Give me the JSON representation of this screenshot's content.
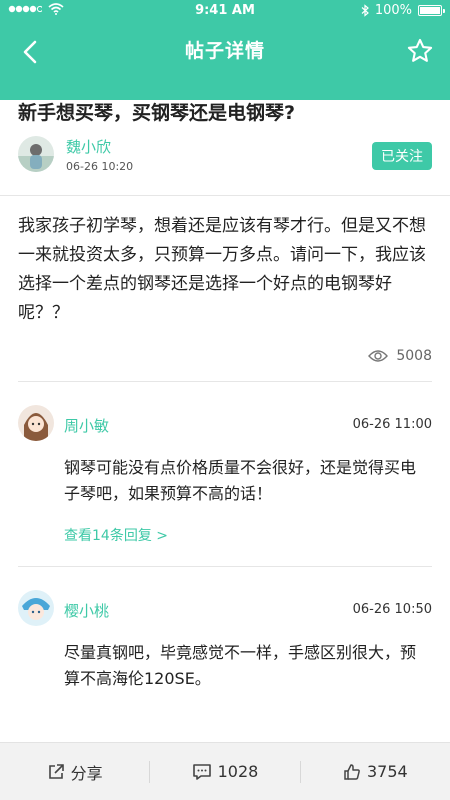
{
  "status_bar": {
    "time": "9:41 AM",
    "battery": "100%"
  },
  "nav": {
    "title": "帖子详情"
  },
  "post": {
    "title": "新手想买琴，买钢琴还是电钢琴?",
    "author": "魏小欣",
    "time": "06-26 10:20",
    "follow_label": "已关注",
    "body": "我家孩子初学琴，想着还是应该有琴才行。但是又不想一来就投资太多，只预算一万多点。请问一下，我应该选择一个差点的钢琴还是选择一个好点的电钢琴好呢？？",
    "views": "5008"
  },
  "comments": [
    {
      "name": "周小敏",
      "time": "06-26  11:00",
      "text": "钢琴可能没有点价格质量不会很好，还是觉得买电子琴吧，如果预算不高的话！",
      "replies": "查看14条回复 >"
    },
    {
      "name": "樱小桃",
      "time": "06-26  10:50",
      "text": "尽量真钢吧，毕竟感觉不一样，手感区别很大，预算不高海伦120SE。"
    }
  ],
  "bottom_bar": {
    "share_label": "分享",
    "comment_count": "1028",
    "like_count": "3754"
  },
  "colors": {
    "accent": "#3ec9a7"
  }
}
